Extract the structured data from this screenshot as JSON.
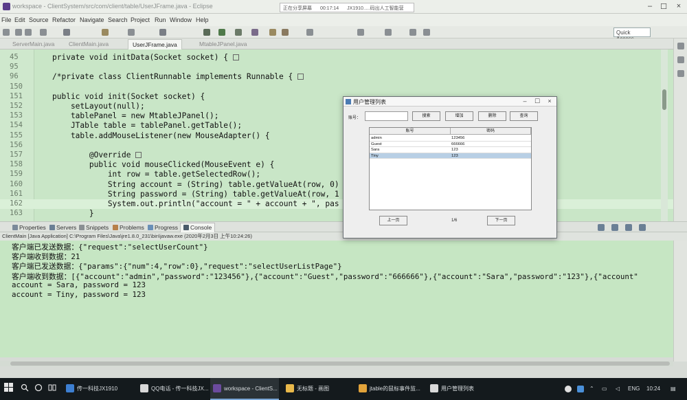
{
  "window": {
    "title": "workspace - ClientSystem/src/com/client/table/UserJFrame.java - Eclipse",
    "recording_banner": [
      "正在分享屏幕",
      "00:17:14",
      "JX1910.....码出人工智能营"
    ]
  },
  "menubar": [
    "File",
    "Edit",
    "Source",
    "Refactor",
    "Navigate",
    "Search",
    "Project",
    "Run",
    "Window",
    "Help"
  ],
  "toolbar": {
    "quick_access": "Quick Access"
  },
  "editor_tabs": [
    {
      "label": "ServerMain.java",
      "active": false
    },
    {
      "label": "ClientMain.java",
      "active": false
    },
    {
      "label": "UserJFrame.java",
      "active": true
    },
    {
      "label": "MtableJPanel.java",
      "active": false
    }
  ],
  "editor": {
    "lines": [
      {
        "n": "45",
        "fold": true,
        "text": "private void initData(Socket socket) {"
      },
      {
        "n": "95",
        "fold": false,
        "text": ""
      },
      {
        "n": "96",
        "fold": true,
        "text": "/*private class ClientRunnable implements Runnable {"
      },
      {
        "n": "150",
        "fold": false,
        "text": ""
      },
      {
        "n": "151",
        "fold": false,
        "text": "public void init(Socket socket) {"
      },
      {
        "n": "152",
        "fold": false,
        "text": "    setLayout(null);"
      },
      {
        "n": "153",
        "fold": false,
        "text": "    tablePanel = new MtableJPanel();"
      },
      {
        "n": "154",
        "fold": false,
        "text": "    JTable table = tablePanel.getTable();"
      },
      {
        "n": "155",
        "fold": false,
        "text": "    table.addMouseListener(new MouseAdapter() {"
      },
      {
        "n": "156",
        "fold": false,
        "text": ""
      },
      {
        "n": "157",
        "fold": true,
        "text": "        @Override"
      },
      {
        "n": "158",
        "fold": false,
        "text": "        public void mouseClicked(MouseEvent e) {"
      },
      {
        "n": "159",
        "fold": false,
        "text": "            int row = table.getSelectedRow();"
      },
      {
        "n": "160",
        "fold": false,
        "text": "            String account = (String) table.getValueAt(row, 0)"
      },
      {
        "n": "161",
        "fold": false,
        "text": "            String password = (String) table.getValueAt(row, 1"
      },
      {
        "n": "162",
        "fold": false,
        "text": "            System.out.println(\"account = \" + account + \", pas"
      },
      {
        "n": "163",
        "fold": false,
        "text": "        }"
      }
    ]
  },
  "panel_tabs": [
    {
      "label": "Properties",
      "active": false
    },
    {
      "label": "Servers",
      "active": false
    },
    {
      "label": "Snippets",
      "active": false
    },
    {
      "label": "Problems",
      "active": false
    },
    {
      "label": "Progress",
      "active": false
    },
    {
      "label": "Console",
      "active": true
    }
  ],
  "console": {
    "header": "ClientMain [Java Application] C:\\Program Files\\Java\\jre1.8.0_231\\bin\\javaw.exe (2020年2月3日 上午10:24:26)",
    "lines": [
      "客户端已发送数据：{\"request\":\"selectUserCount\"}",
      "客户端收到数据：21",
      "客户端已发送数据：{\"params\":{\"num\":4,\"row\":0},\"request\":\"selectUserListPage\"}",
      "客户端收到数据：[{\"account\":\"admin\",\"password\":\"123456\"},{\"account\":\"Guest\",\"password\":\"666666\"},{\"account\":\"Sara\",\"password\":\"123\"},{\"account\"",
      "account = Sara, password = 123",
      "account = Tiny, password = 123"
    ]
  },
  "dialog": {
    "title": "用户管理列表",
    "search_label": "账号：",
    "buttons": [
      "搜索",
      "增加",
      "删除",
      "查询"
    ],
    "table": {
      "headers": [
        "账号",
        "密码"
      ],
      "rows": [
        [
          "admin",
          "123456"
        ],
        [
          "Guest",
          "666666"
        ],
        [
          "Sara",
          "123"
        ],
        [
          "Tiny",
          "123"
        ]
      ],
      "selected_row": 3
    },
    "prev_label": "上一页",
    "next_label": "下一页",
    "page_text": "1/6"
  },
  "taskbar": {
    "items": [
      {
        "label": "传一科技JX1910",
        "color": "#3d7fd1",
        "active": false
      },
      {
        "label": "QQ电话 - 传一科技JX...",
        "color": "#d8d8d8",
        "active": false
      },
      {
        "label": "workspace - ClientS...",
        "color": "#6b4b9e",
        "active": true
      },
      {
        "label": "无标题 - 画图",
        "color": "#e8b84a",
        "active": false
      },
      {
        "label": "jtable的鼠标事件监...",
        "color": "#e2a33a",
        "active": false
      },
      {
        "label": "用户管理列表",
        "color": "#d9d9d9",
        "active": false
      }
    ],
    "lang": "ENG",
    "time": "10:24"
  }
}
